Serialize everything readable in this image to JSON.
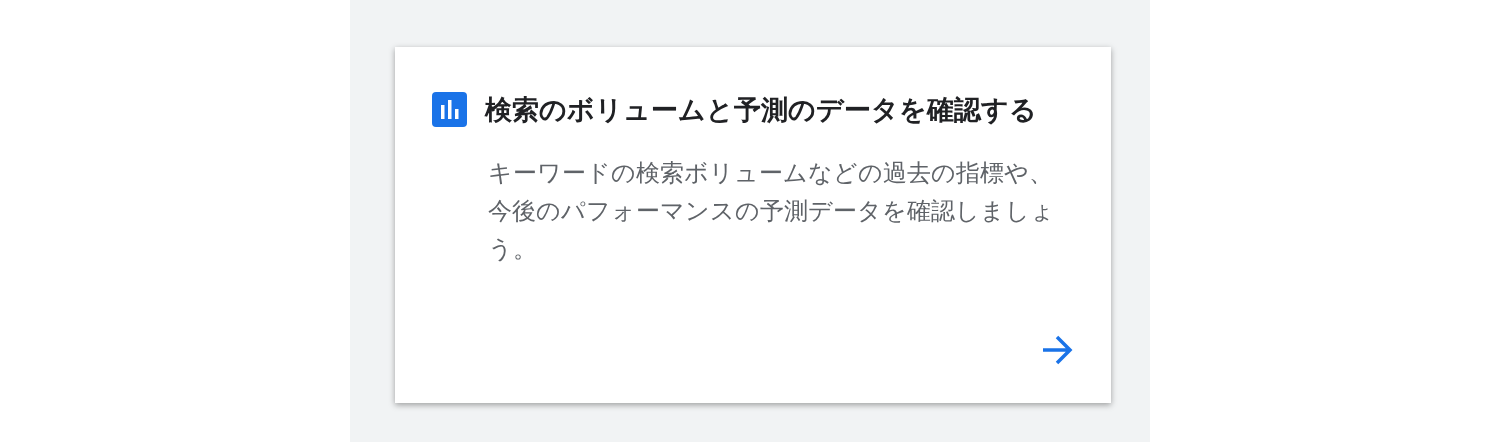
{
  "card": {
    "title": "検索のボリュームと予測のデータを確認する",
    "description": "キーワードの検索ボリュームなどの過去の指標や、今後のパフォーマンスの予測データを確認しましょう。"
  }
}
